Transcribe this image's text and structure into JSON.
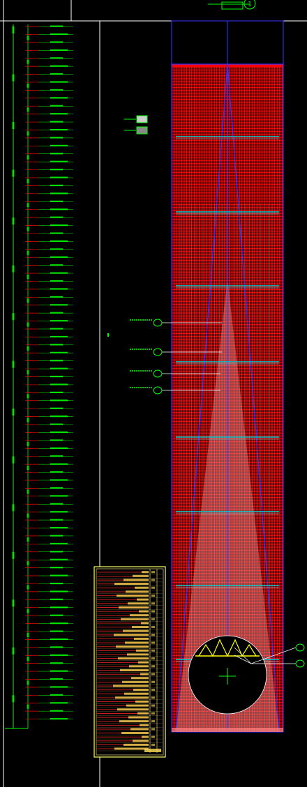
{
  "colors": {
    "background": "#000000",
    "frame": "#ffffff",
    "dimension": "#00ff00",
    "elevation_red": "#ff0000",
    "outline_blue": "#3333ff",
    "section_cyan": "#00c8c8",
    "legend_border": "#ffff66",
    "legend_fill_red": "#aa0000"
  },
  "title_block": {
    "symbol": "1"
  },
  "left_dimension": {
    "tick_count": 88
  },
  "legend": {
    "swatch_1_fill": "#cccccc",
    "swatch_2_fill": "#888888"
  },
  "callouts": {
    "count": 4,
    "right_callouts": 2
  },
  "schedule": {
    "rows": 46
  }
}
